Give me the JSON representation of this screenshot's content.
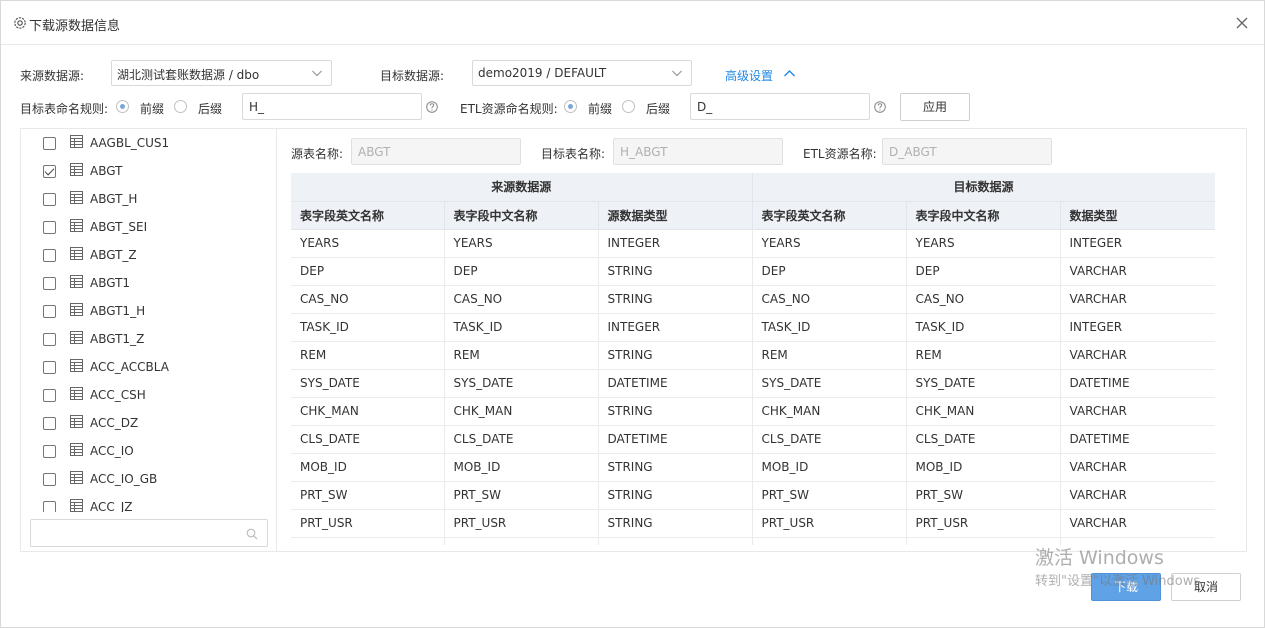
{
  "dialog": {
    "title": "下载源数据信息",
    "close_icon": "close-icon"
  },
  "form": {
    "source_label": "来源数据源:",
    "source_value": "湖北测试套账数据源 / dbo",
    "target_label": "目标数据源:",
    "target_value": "demo2019 / DEFAULT",
    "advanced_label": "高级设置",
    "table_naming_label": "目标表命名规则:",
    "prefix_label": "前缀",
    "suffix_label": "后缀",
    "table_naming_value": "H_",
    "etl_naming_label": "ETL资源命名规则:",
    "etl_prefix_label": "前缀",
    "etl_suffix_label": "后缀",
    "etl_naming_value": "D_",
    "apply_label": "应用"
  },
  "tree": {
    "items": [
      {
        "label": "AAGBL_CUS1",
        "checked": false
      },
      {
        "label": "ABGT",
        "checked": true
      },
      {
        "label": "ABGT_H",
        "checked": false
      },
      {
        "label": "ABGT_SEI",
        "checked": false
      },
      {
        "label": "ABGT_Z",
        "checked": false
      },
      {
        "label": "ABGT1",
        "checked": false
      },
      {
        "label": "ABGT1_H",
        "checked": false
      },
      {
        "label": "ABGT1_Z",
        "checked": false
      },
      {
        "label": "ACC_ACCBLA",
        "checked": false
      },
      {
        "label": "ACC_CSH",
        "checked": false
      },
      {
        "label": "ACC_DZ",
        "checked": false
      },
      {
        "label": "ACC_IO",
        "checked": false
      },
      {
        "label": "ACC_IO_GB",
        "checked": false
      },
      {
        "label": "ACC_JZ",
        "checked": false
      }
    ],
    "search_placeholder": ""
  },
  "detail": {
    "source_table_label": "源表名称:",
    "source_table_value": "ABGT",
    "target_table_label": "目标表名称:",
    "target_table_value": "H_ABGT",
    "etl_name_label": "ETL资源名称:",
    "etl_name_value": "D_ABGT"
  },
  "grid": {
    "group_source": "来源数据源",
    "group_target": "目标数据源",
    "columns": [
      "表字段英文名称",
      "表字段中文名称",
      "源数据类型",
      "表字段英文名称",
      "表字段中文名称",
      "数据类型"
    ],
    "rows": [
      [
        "YEARS",
        "YEARS",
        "INTEGER",
        "YEARS",
        "YEARS",
        "INTEGER"
      ],
      [
        "DEP",
        "DEP",
        "STRING",
        "DEP",
        "DEP",
        "VARCHAR"
      ],
      [
        "CAS_NO",
        "CAS_NO",
        "STRING",
        "CAS_NO",
        "CAS_NO",
        "VARCHAR"
      ],
      [
        "TASK_ID",
        "TASK_ID",
        "INTEGER",
        "TASK_ID",
        "TASK_ID",
        "INTEGER"
      ],
      [
        "REM",
        "REM",
        "STRING",
        "REM",
        "REM",
        "VARCHAR"
      ],
      [
        "SYS_DATE",
        "SYS_DATE",
        "DATETIME",
        "SYS_DATE",
        "SYS_DATE",
        "DATETIME"
      ],
      [
        "CHK_MAN",
        "CHK_MAN",
        "STRING",
        "CHK_MAN",
        "CHK_MAN",
        "VARCHAR"
      ],
      [
        "CLS_DATE",
        "CLS_DATE",
        "DATETIME",
        "CLS_DATE",
        "CLS_DATE",
        "DATETIME"
      ],
      [
        "MOB_ID",
        "MOB_ID",
        "STRING",
        "MOB_ID",
        "MOB_ID",
        "VARCHAR"
      ],
      [
        "PRT_SW",
        "PRT_SW",
        "STRING",
        "PRT_SW",
        "PRT_SW",
        "VARCHAR"
      ],
      [
        "PRT_USR",
        "PRT_USR",
        "STRING",
        "PRT_USR",
        "PRT_USR",
        "VARCHAR"
      ],
      [
        "",
        "",
        "",
        "",
        "",
        ""
      ]
    ]
  },
  "footer": {
    "download_label": "下载",
    "cancel_label": "取消"
  },
  "watermark": {
    "line1": "激活 Windows",
    "line2": "转到\"设置\"以激活 Windows。"
  }
}
